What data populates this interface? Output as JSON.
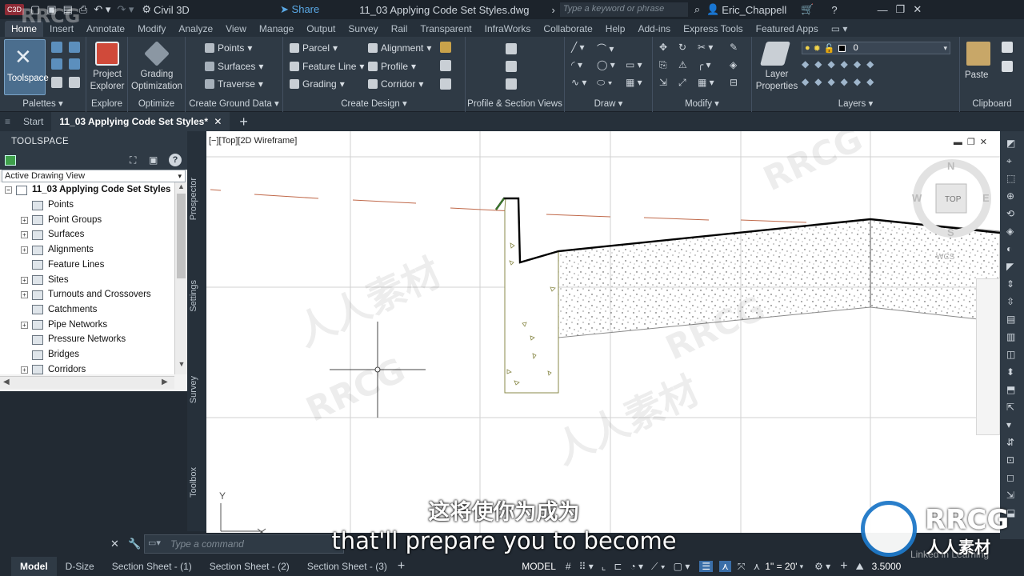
{
  "titlebar": {
    "app_badge": "C3D",
    "workspace": "Civil 3D",
    "share": "Share",
    "doc_title": "11_03 Applying Code Set Styles.dwg",
    "search_placeholder": "Type a keyword or phrase",
    "user": "Eric_Chappell"
  },
  "ribbon_tabs": [
    "Home",
    "Insert",
    "Annotate",
    "Modify",
    "Analyze",
    "View",
    "Manage",
    "Output",
    "Survey",
    "Rail",
    "Transparent",
    "InfraWorks",
    "Collaborate",
    "Help",
    "Add-ins",
    "Express Tools",
    "Featured Apps"
  ],
  "ribbon": {
    "palettes": {
      "toolspace": "Toolspace",
      "title": "Palettes"
    },
    "explore": {
      "project_explorer": "Project Explorer",
      "title": "Explore"
    },
    "optimize": {
      "grading_opt": "Grading Optimization",
      "title": "Optimize"
    },
    "ground": {
      "points": "Points",
      "surfaces": "Surfaces",
      "traverse": "Traverse",
      "title": "Create Ground Data"
    },
    "design": {
      "parcel": "Parcel",
      "feature_line": "Feature Line",
      "grading": "Grading",
      "alignment": "Alignment",
      "profile": "Profile",
      "corridor": "Corridor",
      "title": "Create Design"
    },
    "profile_views": {
      "title": "Profile & Section Views"
    },
    "draw": {
      "title": "Draw"
    },
    "modify": {
      "title": "Modify"
    },
    "layers": {
      "layer_properties": "Layer Properties",
      "layer_value": "0",
      "title": "Layers"
    },
    "clipboard": {
      "paste": "Paste",
      "title": "Clipboard"
    }
  },
  "doc_tabs": {
    "start": "Start",
    "active": "11_03 Applying Code Set Styles*"
  },
  "toolspace": {
    "title": "TOOLSPACE",
    "view_dropdown": "Active Drawing View",
    "root": "11_03 Applying Code Set Styles",
    "items": [
      {
        "label": "Points",
        "exp": ""
      },
      {
        "label": "Point Groups",
        "exp": "+"
      },
      {
        "label": "Surfaces",
        "exp": "+"
      },
      {
        "label": "Alignments",
        "exp": "+"
      },
      {
        "label": "Feature Lines",
        "exp": ""
      },
      {
        "label": "Sites",
        "exp": "+"
      },
      {
        "label": "Turnouts and Crossovers",
        "exp": "+"
      },
      {
        "label": "Catchments",
        "exp": ""
      },
      {
        "label": "Pipe Networks",
        "exp": "+"
      },
      {
        "label": "Pressure Networks",
        "exp": ""
      },
      {
        "label": "Bridges",
        "exp": ""
      },
      {
        "label": "Corridors",
        "exp": "+"
      }
    ],
    "side_tabs": [
      "Prospector",
      "Settings",
      "Survey",
      "Toolbox"
    ]
  },
  "viewport": {
    "label": "[−][Top][2D Wireframe]",
    "viewcube": {
      "top": "TOP",
      "n": "N",
      "w": "W",
      "e": "E",
      "s": "S",
      "wcs": "WCS"
    },
    "ucs_y": "Y"
  },
  "command": {
    "placeholder": "Type a command"
  },
  "status": {
    "layout_tabs": [
      "Model",
      "D-Size",
      "Section Sheet - (1)",
      "Section Sheet - (2)",
      "Section Sheet - (3)"
    ],
    "model_btn": "MODEL",
    "scale": "1\" = 20'",
    "value": "3.5000"
  },
  "subtitles": {
    "cn": "这将使你为成为",
    "en": "that'll prepare you to become"
  },
  "watermark": {
    "brand": "RRCG",
    "sub": "人人素材",
    "linkedin": "Linked in Learning"
  }
}
